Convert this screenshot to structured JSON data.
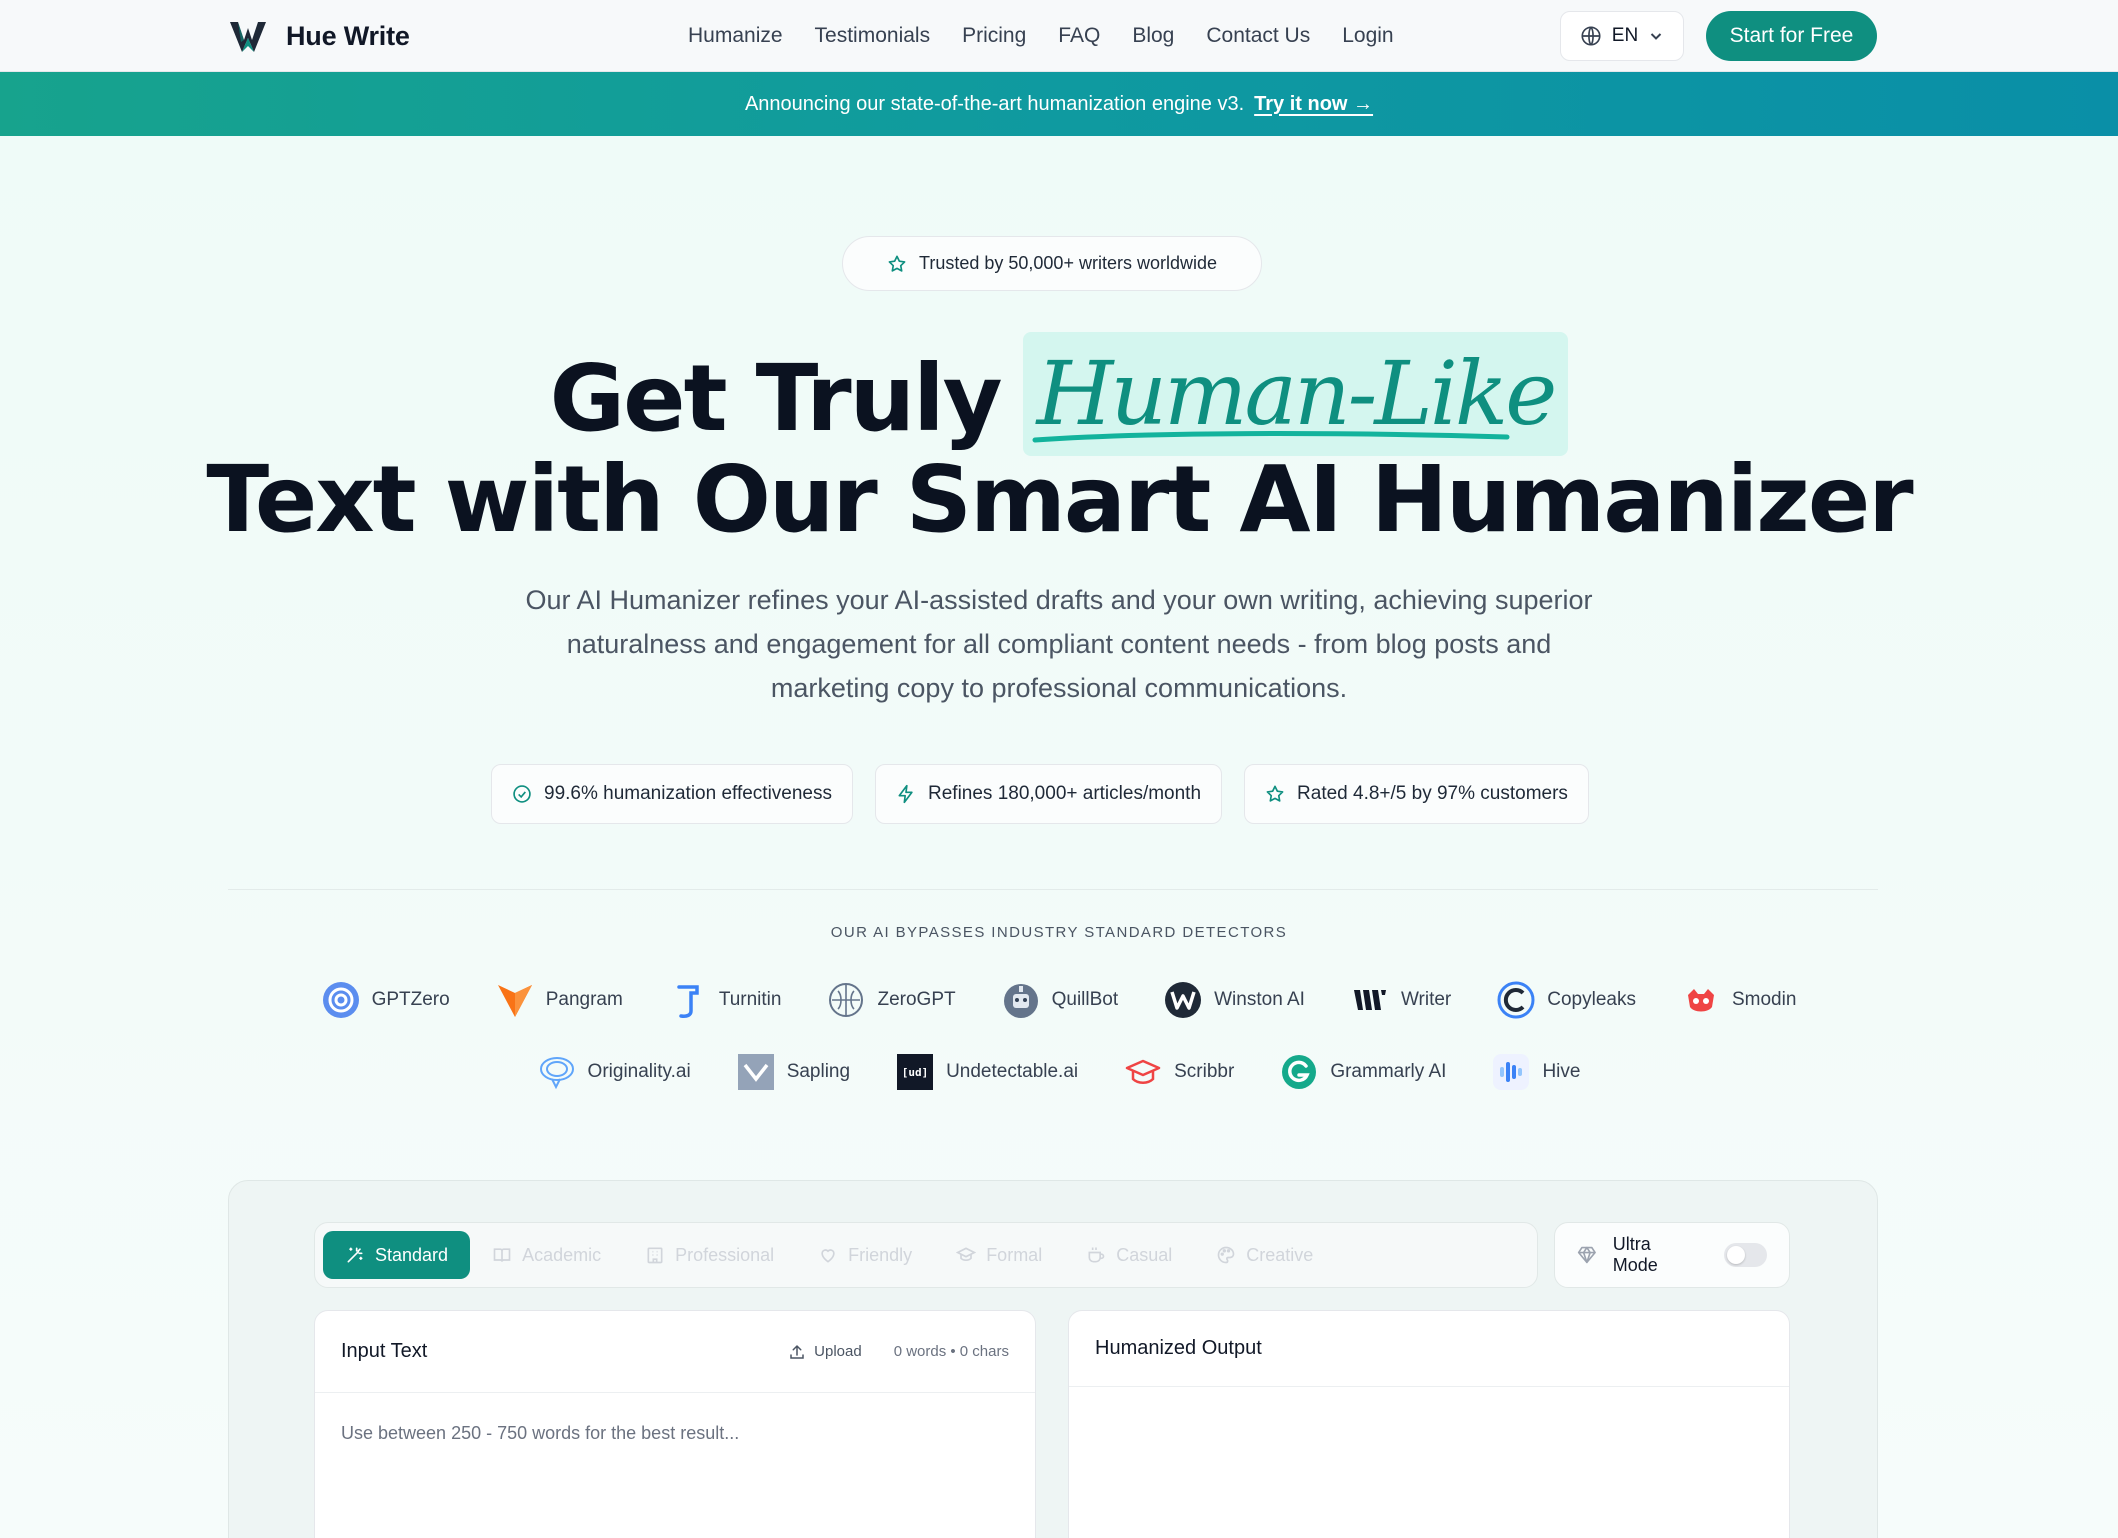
{
  "brand": {
    "name": "Hue Write"
  },
  "nav": [
    "Humanize",
    "Testimonials",
    "Pricing",
    "FAQ",
    "Blog",
    "Contact Us",
    "Login"
  ],
  "language": {
    "selected": "EN"
  },
  "header_cta": "Start for Free",
  "announcement": {
    "text": "Announcing our state-of-the-art humanization engine v3.",
    "link": "Try it now →"
  },
  "hero": {
    "badge": "Trusted by 50,000+ writers worldwide",
    "title_part1": "Get Truly",
    "title_highlight": "Human-Like",
    "title_line2": "Text with Our Smart AI Humanizer",
    "subtitle": "Our AI Humanizer refines your AI-assisted drafts and your own writing, achieving superior naturalness and engagement for all compliant content needs - from blog posts and marketing copy to professional communications."
  },
  "stats": [
    {
      "icon": "check-circle-icon",
      "label": "99.6% humanization effectiveness"
    },
    {
      "icon": "lightning-icon",
      "label": "Refines 180,000+ articles/month"
    },
    {
      "icon": "star-icon",
      "label": "Rated 4.8+/5 by 97% customers"
    }
  ],
  "detectors": {
    "heading": "OUR AI BYPASSES INDUSTRY STANDARD DETECTORS",
    "row1": [
      "GPTZero",
      "Pangram",
      "Turnitin",
      "ZeroGPT",
      "QuillBot",
      "Winston AI",
      "Writer",
      "Copyleaks",
      "Smodin"
    ],
    "row2": [
      "Originality.ai",
      "Sapling",
      "Undetectable.ai",
      "Scribbr",
      "Grammarly AI",
      "Hive"
    ]
  },
  "tool": {
    "modes": [
      "Standard",
      "Academic",
      "Professional",
      "Friendly",
      "Formal",
      "Casual",
      "Creative"
    ],
    "active_mode": "Standard",
    "ultra_mode": {
      "label": "Ultra Mode",
      "enabled": false
    },
    "input": {
      "title": "Input Text",
      "upload": "Upload",
      "counts": "0 words • 0 chars",
      "placeholder": "Use between 250 - 750 words for the best result...",
      "value": ""
    },
    "output": {
      "title": "Humanized Output"
    }
  },
  "colors": {
    "accent": "#0f8f80",
    "highlight_bg": "#d4f6ef",
    "banner_start": "#17a38d",
    "banner_end": "#0a8fa7"
  }
}
